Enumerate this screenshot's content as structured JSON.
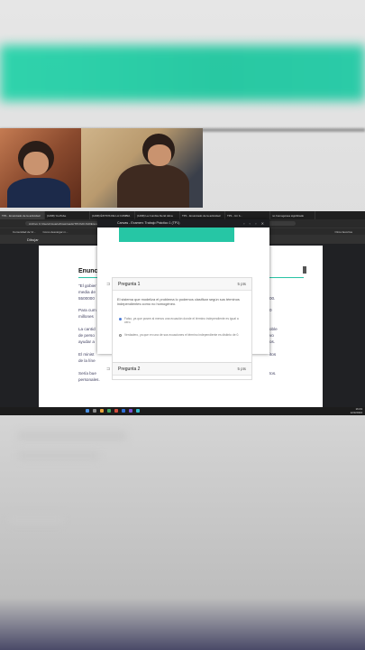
{
  "browser": {
    "tabs": [
      {
        "label": "TP1 - Enunciado de la actividad"
      },
      {
        "label": "(1298) YouTube"
      },
      {
        "label": "(1298) ÉXITOS DE LA CUMBIA"
      },
      {
        "label": "(1298) La Cumbia De El Alma"
      },
      {
        "label": "TP1 - Enunciado de la actividad"
      },
      {
        "label": "TP1 - Un b..."
      },
      {
        "label": "no homogénea significado"
      }
    ],
    "address": "C:/Users/Usuario/Downloads/TP1%20-%20Enunciado%20de%20la%20actividad.pdf",
    "address_label": "Archivo",
    "bookmarks": [
      "Comunidad de Vi...",
      "Como descargar m...",
      "",
      "",
      "",
      "",
      "Otros favoritos"
    ],
    "pdf_toolbar": "Dibujar"
  },
  "document": {
    "title": "Enunc",
    "lines": [
      "\"El gobier",
      "media de",
      "5500000",
      "Para cum",
      "millones",
      "La cantid",
      "de perso",
      "ayudar a",
      "El minist",
      "de la líne",
      "Sería bue",
      "personales."
    ],
    "right_fragments": [
      "00.",
      "0",
      "oble",
      "vo",
      "os.",
      "itos",
      "tos."
    ]
  },
  "modal": {
    "window_title": "Canvas - Examen: Trabajo Práctico 1 (TP1)",
    "questions": [
      {
        "label": "Pregunta 1",
        "points": "5 pts",
        "text": "El sistema que modeliza el problema lo podemos clasificar según sus términos independientes como no homogéneo.",
        "options": [
          {
            "text": "Falso, ya que posee al menos una ecuación donde el término independiente es igual a cero.",
            "selected": true
          },
          {
            "text": "Verdadero, ya que en una de sus ecuaciones el término independiente es distinto de 0.",
            "selected": false
          }
        ]
      },
      {
        "label": "Pregunta 2",
        "points": "5 pts"
      }
    ]
  },
  "taskbar": {
    "time": "16:43",
    "date": "12/3/2024"
  }
}
